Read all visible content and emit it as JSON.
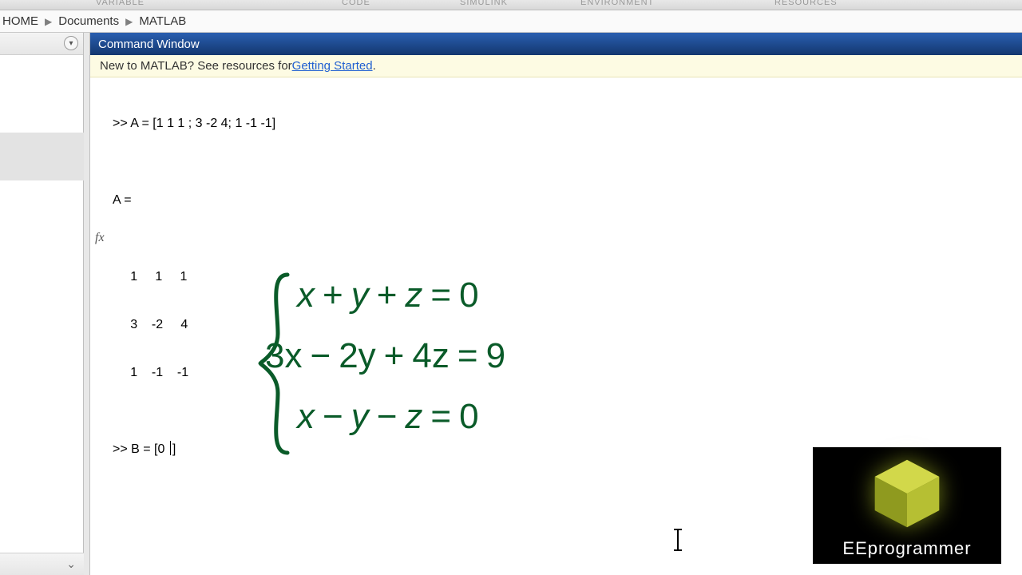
{
  "toolstrip": {
    "variable": "VARIABLE",
    "code": "CODE",
    "simulink": "SIMULINK",
    "environment": "ENVIRONMENT",
    "resources": "RESOURCES"
  },
  "breadcrumb": {
    "seg0": "HOME",
    "seg1": "Documents",
    "seg2": "MATLAB"
  },
  "cmdwin": {
    "title": "Command Window",
    "info_prefix": "New to MATLAB? See resources for ",
    "info_link": "Getting Started",
    "info_suffix": ".",
    "line1": ">> A = [1 1 1 ; 3 -2 4; 1 -1 -1]",
    "blank": "",
    "line2": "A =",
    "row1": "     1     1     1",
    "row2": "     3    -2     4",
    "row3": "     1    -1    -1",
    "prompt2_pre": ">> B = [0 ",
    "prompt2_post": "]",
    "fx": "fx"
  },
  "equations": {
    "eq1": {
      "a": "x",
      "op1": "+",
      "b": "y",
      "op2": "+",
      "c": "z",
      "eq": "=",
      "r": "0"
    },
    "eq2": {
      "a": "3x",
      "op1": "−",
      "b": "2y",
      "op2": "+",
      "c": "4z",
      "eq": "=",
      "r": "9"
    },
    "eq3": {
      "a": "x",
      "op1": "−",
      "b": "y",
      "op2": "−",
      "c": "z",
      "eq": "=",
      "r": "0"
    }
  },
  "watermark": {
    "text": "EEprogrammer"
  }
}
